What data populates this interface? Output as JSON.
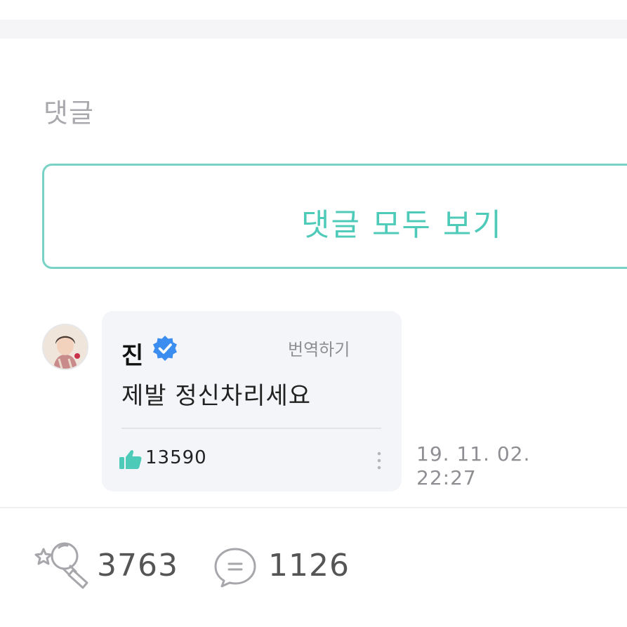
{
  "comments_section": {
    "title": "댓글",
    "view_all_label": "댓글 모두 보기"
  },
  "comment": {
    "author": "진",
    "verified": true,
    "translate_label": "번역하기",
    "text": "제발 정신차리세요",
    "likes": "13590",
    "date": "19. 11. 02.",
    "time": "22:27"
  },
  "footer": {
    "cheer_count": "3763",
    "comment_count": "1126"
  },
  "colors": {
    "accent": "#4ecab9",
    "button_border": "#79d2c6",
    "verified_badge": "#3b8ef0",
    "bubble_bg": "#f4f5f9",
    "muted_text": "#8e8e93"
  },
  "icons": [
    "verified-badge-icon",
    "thumbs-up-icon",
    "more-options-icon",
    "cheer-lightstick-icon",
    "comment-bubble-icon"
  ]
}
